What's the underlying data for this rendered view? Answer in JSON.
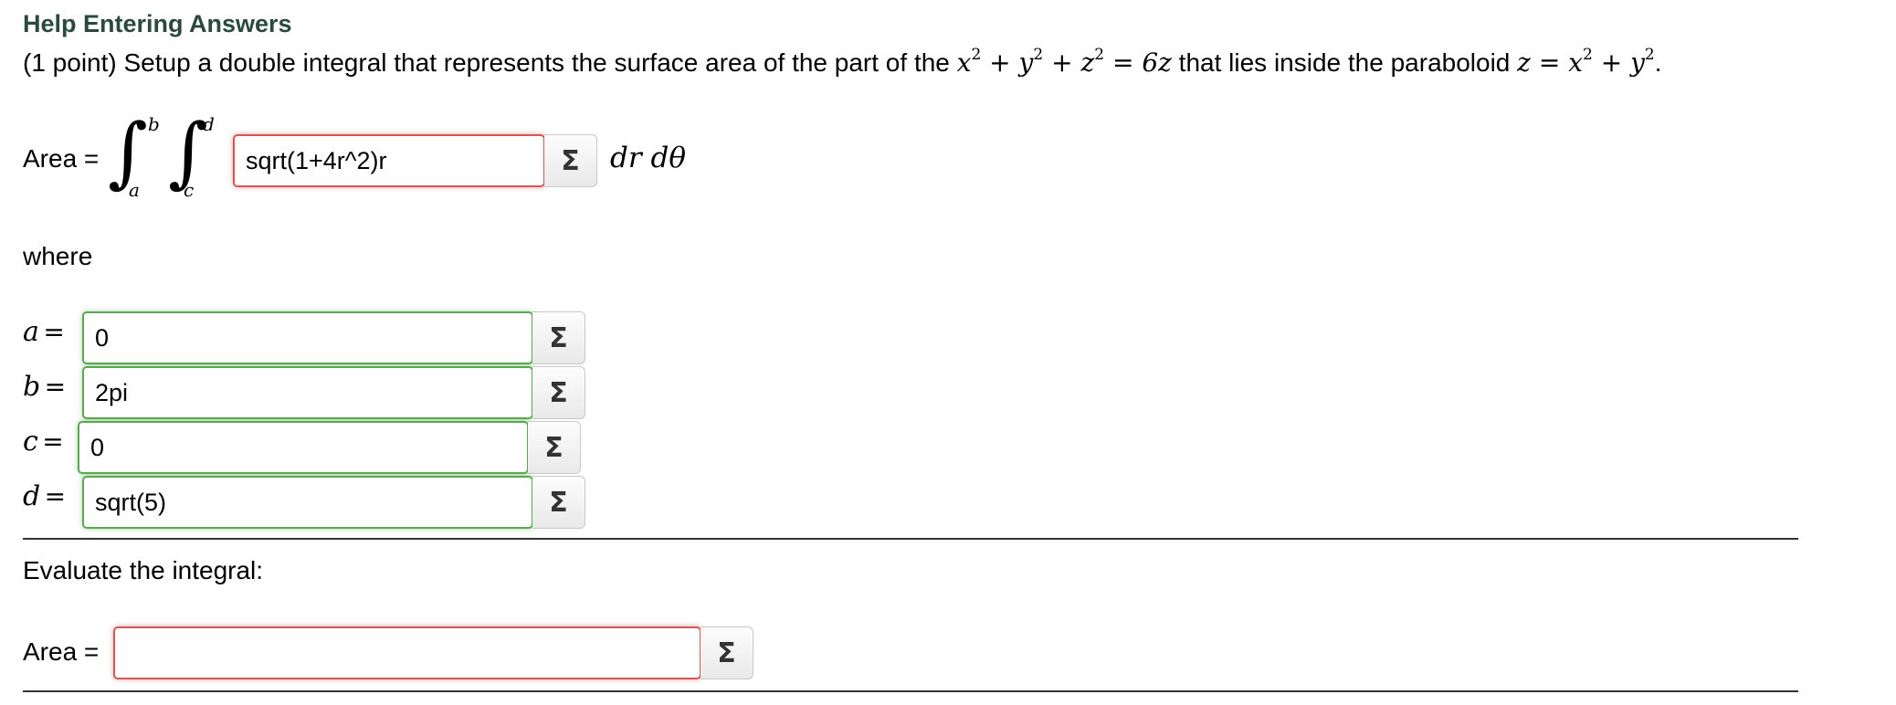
{
  "header": {
    "help_link": "Help Entering Answers"
  },
  "problem": {
    "prefix": "(1 point) Setup a double integral that represents the surface area of the part of the ",
    "sphere_eq": {
      "x": "x",
      "y": "y",
      "z": "z",
      "exp": "2",
      "rhs": "6z"
    },
    "middle": " that lies inside the paraboloid ",
    "paraboloid_eq": {
      "lhs": "z",
      "x": "x",
      "y": "y",
      "exp": "2"
    },
    "suffix": "."
  },
  "integral": {
    "area_label": "Area =",
    "outer_upper": "b",
    "outer_lower": "a",
    "inner_upper": "d",
    "inner_lower": "c",
    "integrand_value": "sqrt(1+4r^2)r",
    "differentials": "dr dθ"
  },
  "where_label": "where",
  "bounds": [
    {
      "var": "a",
      "eq": "=",
      "value": "0",
      "status": "correct"
    },
    {
      "var": "b",
      "eq": "=",
      "value": "2pi",
      "status": "correct"
    },
    {
      "var": "c",
      "eq": "=",
      "value": "0",
      "status": "correct"
    },
    {
      "var": "d",
      "eq": "=",
      "value": "sqrt(5)",
      "status": "correct"
    }
  ],
  "evaluate": {
    "label": "Evaluate the integral:",
    "area_label": "Area =",
    "value": "",
    "status": "incorrect"
  },
  "sigma_icon": "Σ",
  "colors": {
    "help_link": "#2a4a3f",
    "correct": "#5aa84f",
    "incorrect": "#d45858"
  }
}
